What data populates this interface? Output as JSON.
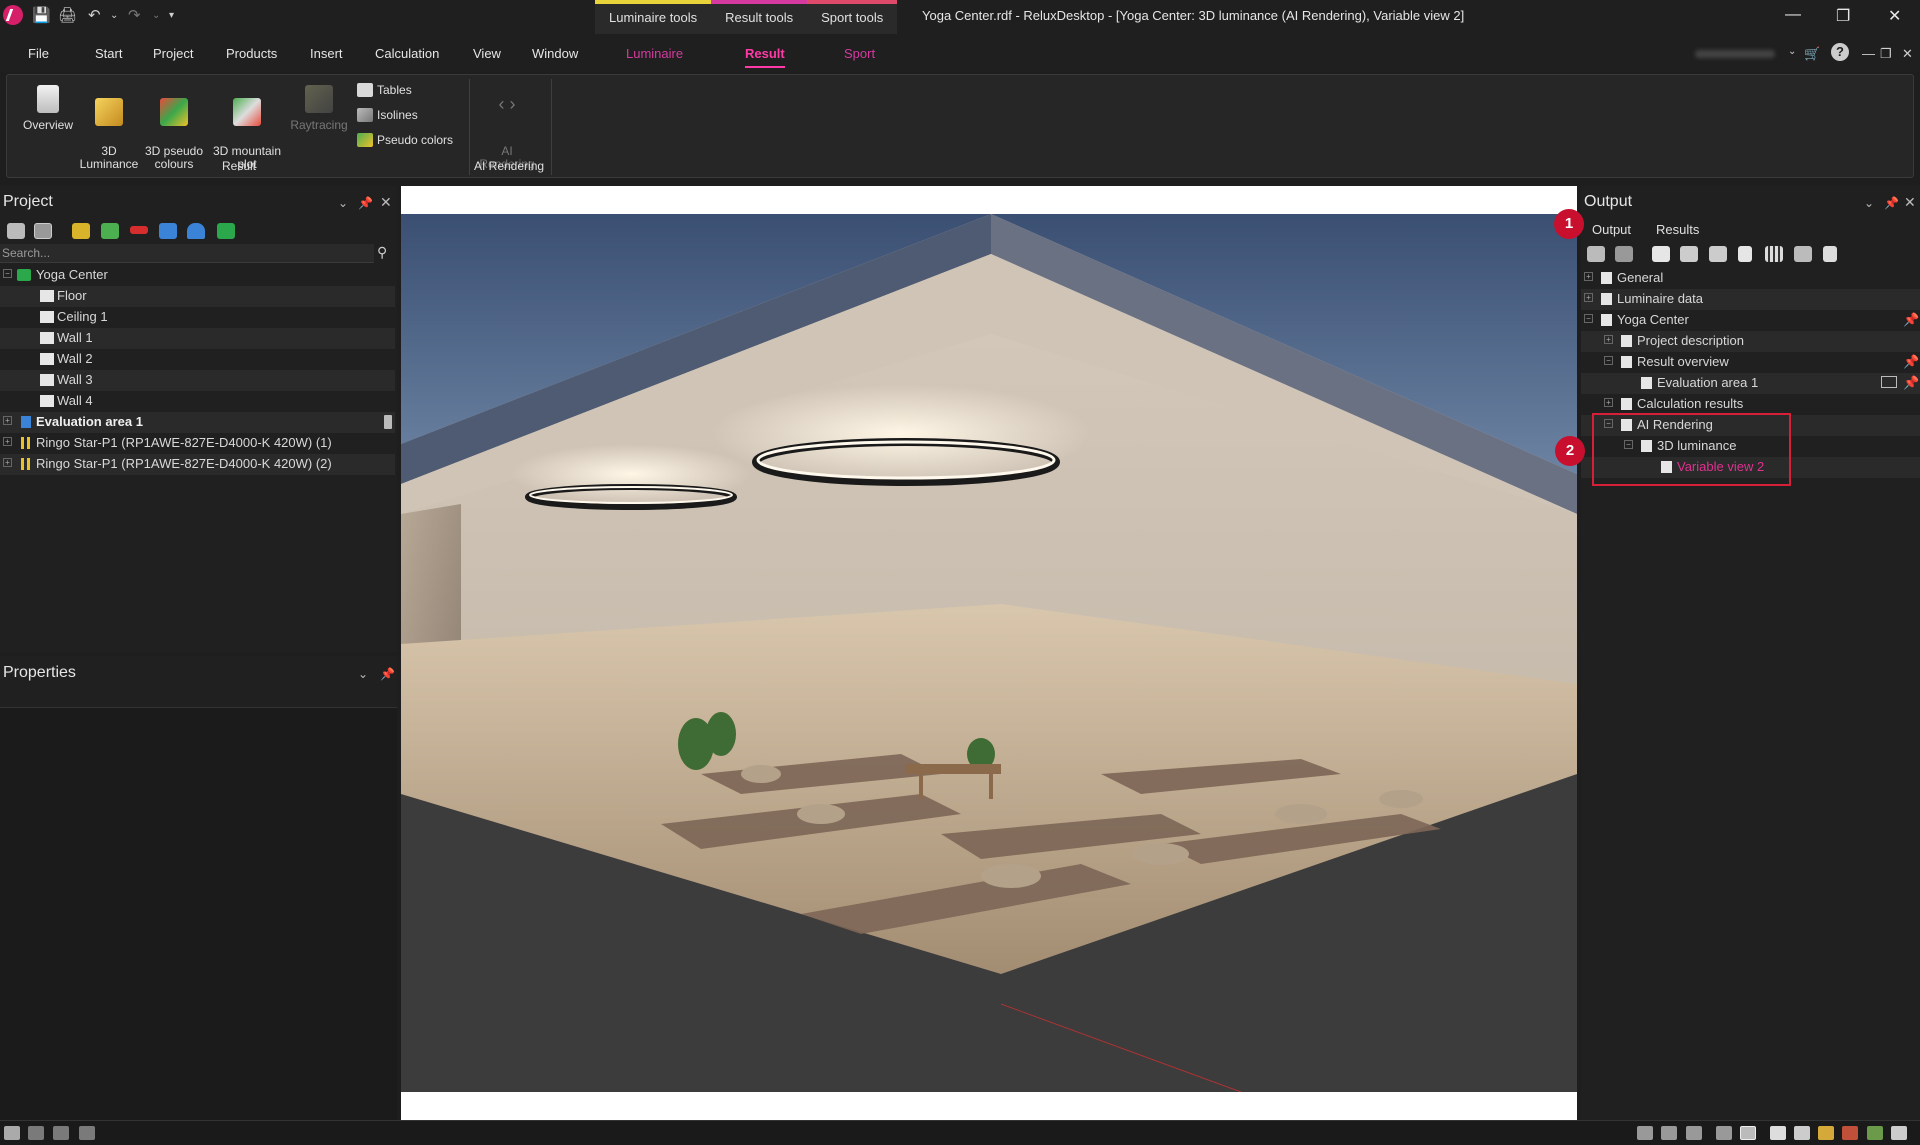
{
  "window": {
    "title": "Yoga Center.rdf - ReluxDesktop - [Yoga Center: 3D luminance (AI Rendering), Variable view 2]",
    "context_tabs": [
      "Luminaire tools",
      "Result tools",
      "Sport tools"
    ]
  },
  "menu": {
    "items": [
      "File",
      "Start",
      "Project",
      "Products",
      "Insert",
      "Calculation",
      "View",
      "Window"
    ],
    "context_items": [
      "Luminaire",
      "Result",
      "Sport"
    ],
    "active": "Result"
  },
  "ribbon": {
    "result_group": {
      "label": "Result",
      "buttons": [
        {
          "label": "Overview"
        },
        {
          "label": "3D\nLuminance"
        },
        {
          "label": "3D pseudo\ncolours"
        },
        {
          "label": "3D mountain\nplot"
        },
        {
          "label": "Raytracing"
        }
      ],
      "small_buttons": [
        "Tables",
        "Isolines",
        "Pseudo colors"
      ]
    },
    "ai_group": {
      "label": "AI Rendering",
      "button": "AI\nRendering"
    }
  },
  "project_panel": {
    "title": "Project",
    "search_placeholder": "Search...",
    "tree": [
      {
        "label": "Yoga Center",
        "level": 0,
        "bold": false
      },
      {
        "label": "Floor",
        "level": 1
      },
      {
        "label": "Ceiling 1",
        "level": 1
      },
      {
        "label": "Wall 1",
        "level": 1
      },
      {
        "label": "Wall 2",
        "level": 1
      },
      {
        "label": "Wall 3",
        "level": 1
      },
      {
        "label": "Wall 4",
        "level": 1
      },
      {
        "label": "Evaluation area 1",
        "level": 0,
        "bold": true
      },
      {
        "label": "Ringo Star-P1 (RP1AWE-827E-D4000-K 420W) (1)",
        "level": 0
      },
      {
        "label": "Ringo Star-P1 (RP1AWE-827E-D4000-K 420W) (2)",
        "level": 0
      }
    ]
  },
  "properties_panel": {
    "title": "Properties"
  },
  "output_panel": {
    "title": "Output",
    "tabs": [
      "Output",
      "Results"
    ],
    "tree": [
      {
        "label": "General",
        "level": 0
      },
      {
        "label": "Luminaire data",
        "level": 0
      },
      {
        "label": "Yoga Center",
        "level": 0
      },
      {
        "label": "Project description",
        "level": 1
      },
      {
        "label": "Result overview",
        "level": 1
      },
      {
        "label": "Evaluation area 1",
        "level": 2
      },
      {
        "label": "Calculation results",
        "level": 1
      },
      {
        "label": "AI Rendering",
        "level": 1
      },
      {
        "label": "3D luminance",
        "level": 2
      },
      {
        "label": "Variable view 2",
        "level": 3,
        "selected": true
      }
    ],
    "callouts": [
      "1",
      "2"
    ]
  },
  "colors": {
    "accent": "#ff3aa6",
    "callout": "#c8102e",
    "panel_bg": "#202020",
    "titlebar_bg": "#1f1f1f"
  }
}
